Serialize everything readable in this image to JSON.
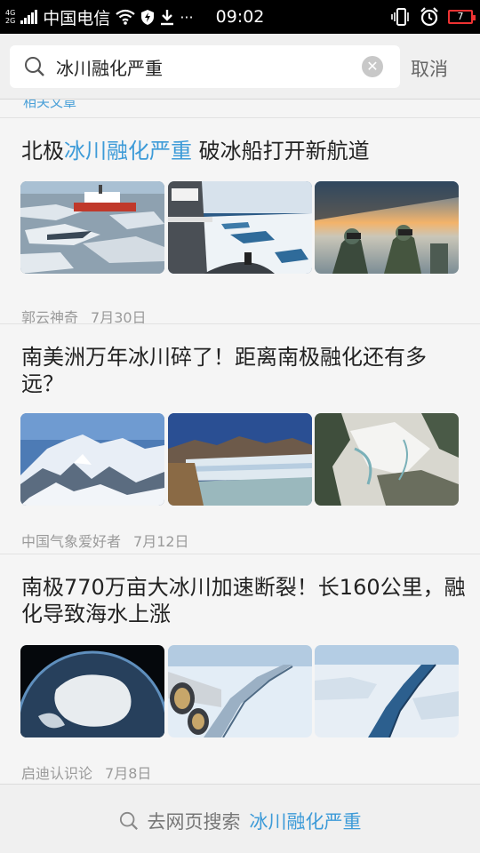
{
  "status_bar": {
    "net_top": "4G",
    "net_bottom": "2G",
    "carrier": "中国电信",
    "time": "09:02",
    "battery": "7",
    "dots": "···",
    "battery_color": "#e33333"
  },
  "search": {
    "query": "冰川融化严重",
    "cancel_label": "取消"
  },
  "related_label": "相关文章",
  "articles": [
    {
      "title_prefix": "北极",
      "title_highlight": "冰川融化严重",
      "title_suffix": " 破冰船打开新航道",
      "author": "郭云神奇",
      "date": "7月30日",
      "thumbs": [
        "icebreaker-on-ice",
        "ship-bow-ice-field",
        "crew-with-binoculars"
      ]
    },
    {
      "title": "南美洲万年冰川碎了！距离南极融化还有多远？",
      "author": "中国气象爱好者",
      "date": "7月12日",
      "thumbs": [
        "snowy-mountains",
        "glacier-front-lake",
        "aerial-glacier"
      ]
    },
    {
      "title": "南极770万亩大冰川加速断裂！长160公里，融化导致海水上涨",
      "author": "启迪认识论",
      "date": "7月8日",
      "thumbs": [
        "antarctica-globe",
        "airplane-over-ice-crack",
        "ice-shelf-rift"
      ]
    }
  ],
  "footer": {
    "prefix": "去网页搜索",
    "keyword": "冰川融化严重"
  },
  "colors": {
    "accent": "#3d9bd8",
    "text": "#222222",
    "meta": "#9a9a9a"
  }
}
